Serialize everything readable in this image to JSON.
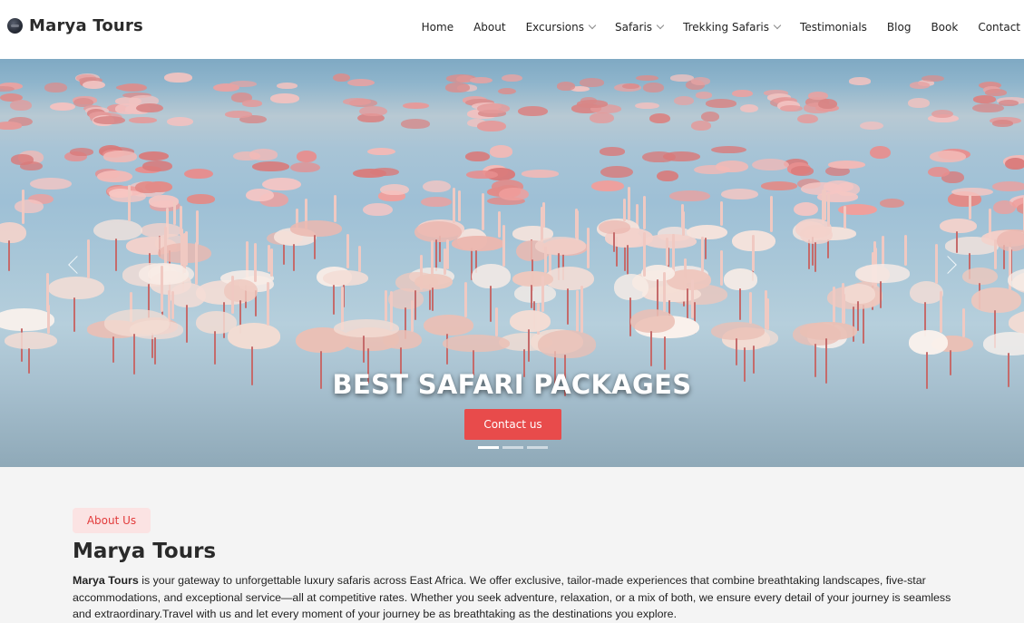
{
  "brand": {
    "name": "Marya Tours"
  },
  "nav": {
    "items": [
      {
        "label": "Home",
        "dropdown": false
      },
      {
        "label": "About",
        "dropdown": false
      },
      {
        "label": "Excursions",
        "dropdown": true
      },
      {
        "label": "Safaris",
        "dropdown": true
      },
      {
        "label": "Trekking Safaris",
        "dropdown": true
      },
      {
        "label": "Testimonials",
        "dropdown": false
      },
      {
        "label": "Blog",
        "dropdown": false
      },
      {
        "label": "Book",
        "dropdown": false
      },
      {
        "label": "Contact",
        "dropdown": false
      }
    ]
  },
  "hero": {
    "title": "BEST SAFARI PACKAGES",
    "button_label": "Contact us",
    "slides": 3,
    "active_slide": 1,
    "image_subject": "flamingos-in-lake",
    "accent_color": "#e84b4b"
  },
  "about": {
    "badge": "About Us",
    "title": "Marya Tours",
    "text_bold": "Marya Tours",
    "text_rest": " is your gateway to unforgettable luxury safaris across East Africa. We offer exclusive, tailor-made experiences that combine breathtaking landscapes, five-star accommodations, and exceptional service—all at competitive rates. Whether you seek adventure, relaxation, or a mix of both, we ensure every detail of your journey is seamless and extraordinary.Travel with us and let every moment of your journey be as breathtaking as the destinations you explore."
  }
}
